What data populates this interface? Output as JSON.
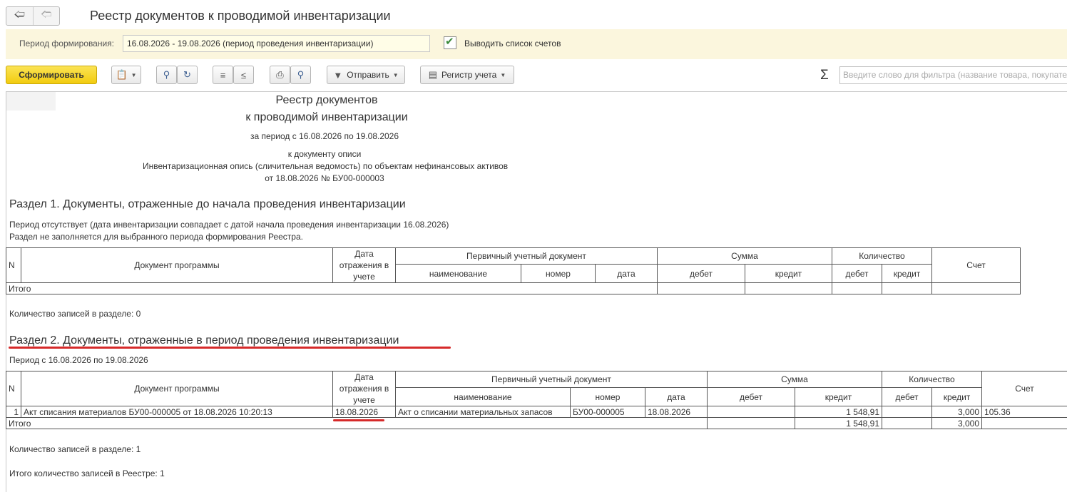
{
  "window": {
    "title": "Реестр документов к проводимой инвентаризации",
    "back_icon": "arrow-left-icon",
    "forward_icon": "arrow-right-icon"
  },
  "params": {
    "period_label": "Период формирования:",
    "period_value": "16.08.2026 - 19.08.2026 (период проведения инвентаризации)",
    "show_accounts_label": "Выводить список счетов",
    "show_accounts_checked": true
  },
  "toolbar": {
    "generate_label": "Сформировать",
    "send_label": "Отправить",
    "register_label": "Регистр учета",
    "sigma": "Σ",
    "search_placeholder": "Введите слово для фильтра (название товара, покупателя, ..."
  },
  "report": {
    "title_line1": "Реестр документов",
    "title_line2": "к проводимой инвентаризации",
    "period_line": "за период с 16.08.2026 по 19.08.2026",
    "doc_line1": "к документу описи",
    "doc_line2": "Инвентаризационная опись (сличительная ведомость) по объектам нефинансовых активов",
    "doc_line3": "от 18.08.2026 № БУ00-000003",
    "headers": {
      "n": "N",
      "doc": "Документ программы",
      "date_reflect": "Дата отражения в учете",
      "primary": "Первичный учетный документ",
      "name": "наименование",
      "number": "номер",
      "date": "дата",
      "sum": "Сумма",
      "debit": "дебет",
      "credit": "кредит",
      "qty": "Количество",
      "account": "Счет"
    },
    "section1": {
      "title": "Раздел 1. Документы, отраженные до начала проведения инвентаризации",
      "note1": "Период отсутствует (дата инвентаризации совпадает с датой начала проведения инвентаризации 16.08.2026)",
      "note2": "Раздел не заполняется для выбранного периода формирования Реестра.",
      "total_label": "Итого",
      "count_line": "Количество записей в разделе: 0"
    },
    "section2": {
      "title": "Раздел 2. Документы, отраженные в период проведения инвентаризации",
      "period": "Период с 16.08.2026 по 19.08.2026",
      "rows": [
        {
          "n": "1",
          "doc": "Акт списания материалов БУ00-000005 от 18.08.2026 10:20:13",
          "date_reflect": "18.08.2026",
          "name": "Акт о списании материальных запасов",
          "number": "БУ00-000005",
          "date": "18.08.2026",
          "sum_debit": "",
          "sum_credit": "1 548,91",
          "qty_debit": "",
          "qty_credit": "3,000",
          "account": "105.36"
        }
      ],
      "total_label": "Итого",
      "total_sum_credit": "1 548,91",
      "total_qty_credit": "3,000",
      "count_line": "Количество записей в разделе: 1"
    },
    "grand_total_line": "Итого количество записей в Реестре: 1"
  },
  "colors": {
    "accent_yellow": "#f2cc0f",
    "param_panel_bg": "#fbf6dd",
    "underline_red": "#d62a2a"
  }
}
